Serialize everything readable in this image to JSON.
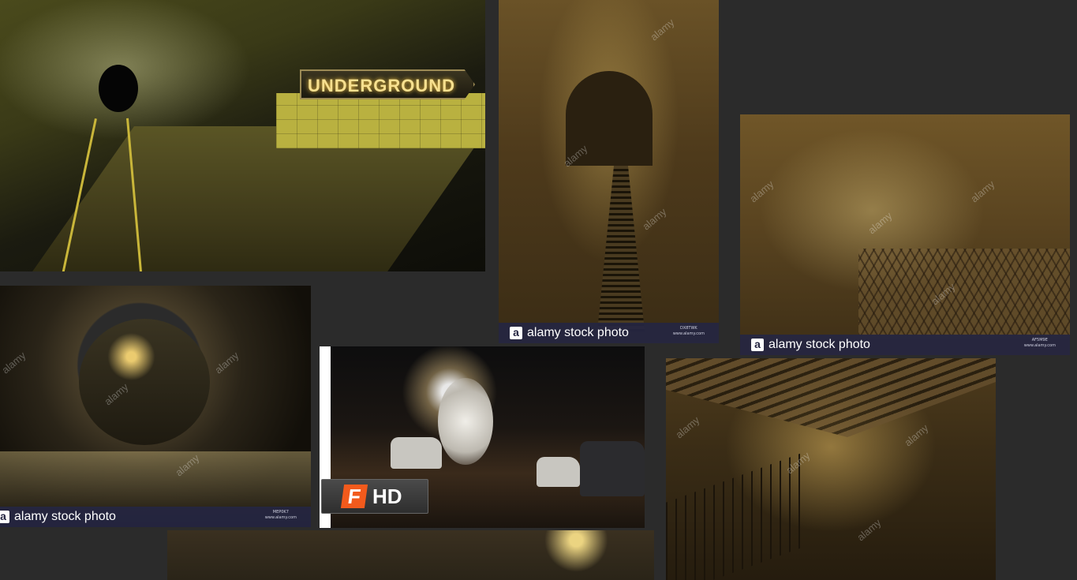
{
  "tiles": {
    "underground": {
      "sign_text": "UNDERGROUND"
    },
    "corridor": {
      "footer_text": "alamy stock photo",
      "footer_logo": "a",
      "code_line1": "DX8TWK",
      "code_line2": "www.alamy.com"
    },
    "catwalk": {
      "footer_text": "alamy stock photo",
      "footer_logo": "a",
      "code_line1": "AF5M9E",
      "code_line2": "www.alamy.com"
    },
    "pipe": {
      "footer_text": "alamy stock photo",
      "footer_logo": "a",
      "code_line1": "MEP0K7",
      "code_line2": "www.alamy.com"
    },
    "street": {
      "badge_logo": "F",
      "badge_text": "HD"
    },
    "sewer": {},
    "bottom": {}
  },
  "watermark_text": "alamy",
  "colors": {
    "page_background": "#2b2b2b",
    "alamy_footer": "#252642",
    "fandango_orange": "#f25a1c"
  },
  "icons": [
    "alamy-logo-icon",
    "fandango-logo-icon"
  ]
}
